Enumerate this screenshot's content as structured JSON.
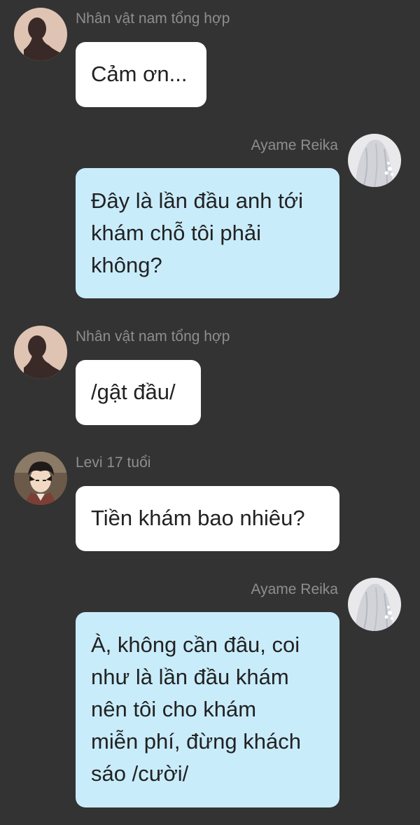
{
  "messages": [
    {
      "sender": "Nhân vật nam tổng hợp",
      "avatar_icon": "silhouette-avatar-icon",
      "direction": "incoming",
      "text": "Cảm ơn..."
    },
    {
      "sender": "Ayame Reika",
      "avatar_icon": "white-haired-girl-avatar-icon",
      "direction": "outgoing",
      "text": "Đây là lần đầu anh tới\nkhám chỗ tôi phải\nkhông?"
    },
    {
      "sender": "Nhân vật nam tổng hợp",
      "avatar_icon": "silhouette-avatar-icon",
      "direction": "incoming",
      "text": "/gật đầu/"
    },
    {
      "sender": "Levi 17 tuổi",
      "avatar_icon": "levi-anime-avatar-icon",
      "direction": "incoming",
      "text": "Tiền khám bao nhiêu?"
    },
    {
      "sender": "Ayame Reika",
      "avatar_icon": "white-haired-girl-avatar-icon",
      "direction": "outgoing",
      "text": "À, không cần đâu, coi\nnhư là lần đầu khám\nnên tôi cho khám\nmiễn phí, đừng khách\nsáo /cười/"
    }
  ],
  "colors": {
    "background": "#333333",
    "incoming_bubble": "#ffffff",
    "outgoing_bubble": "#c9ecfb",
    "sender_name": "#8e8e8e",
    "message_text": "#222222"
  }
}
